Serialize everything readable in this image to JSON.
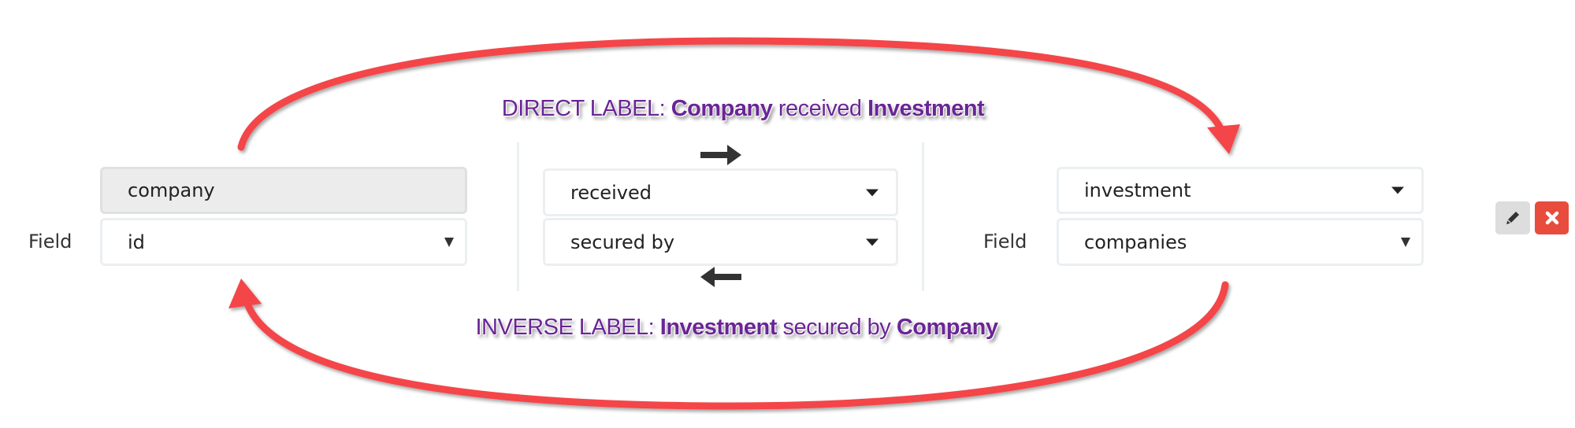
{
  "direct_label": {
    "prefix": "DIRECT LABEL:",
    "source": "Company",
    "verb": "received",
    "target": "Investment"
  },
  "inverse_label": {
    "prefix": "INVERSE LABEL:",
    "source": "Investment",
    "verb": "secured by",
    "target": "Company"
  },
  "left": {
    "entity": "company",
    "field_label": "Field",
    "field_value": "id"
  },
  "middle": {
    "direct_relation": "received",
    "inverse_relation": "secured by"
  },
  "right": {
    "entity": "investment",
    "field_label": "Field",
    "field_value": "companies"
  },
  "actions": {
    "edit_icon": "pencil-icon",
    "delete_icon": "times-icon"
  },
  "colors": {
    "arrow": "#f44448",
    "label": "#6a2596",
    "delete": "#e74c3c",
    "edit": "#dddddd"
  }
}
